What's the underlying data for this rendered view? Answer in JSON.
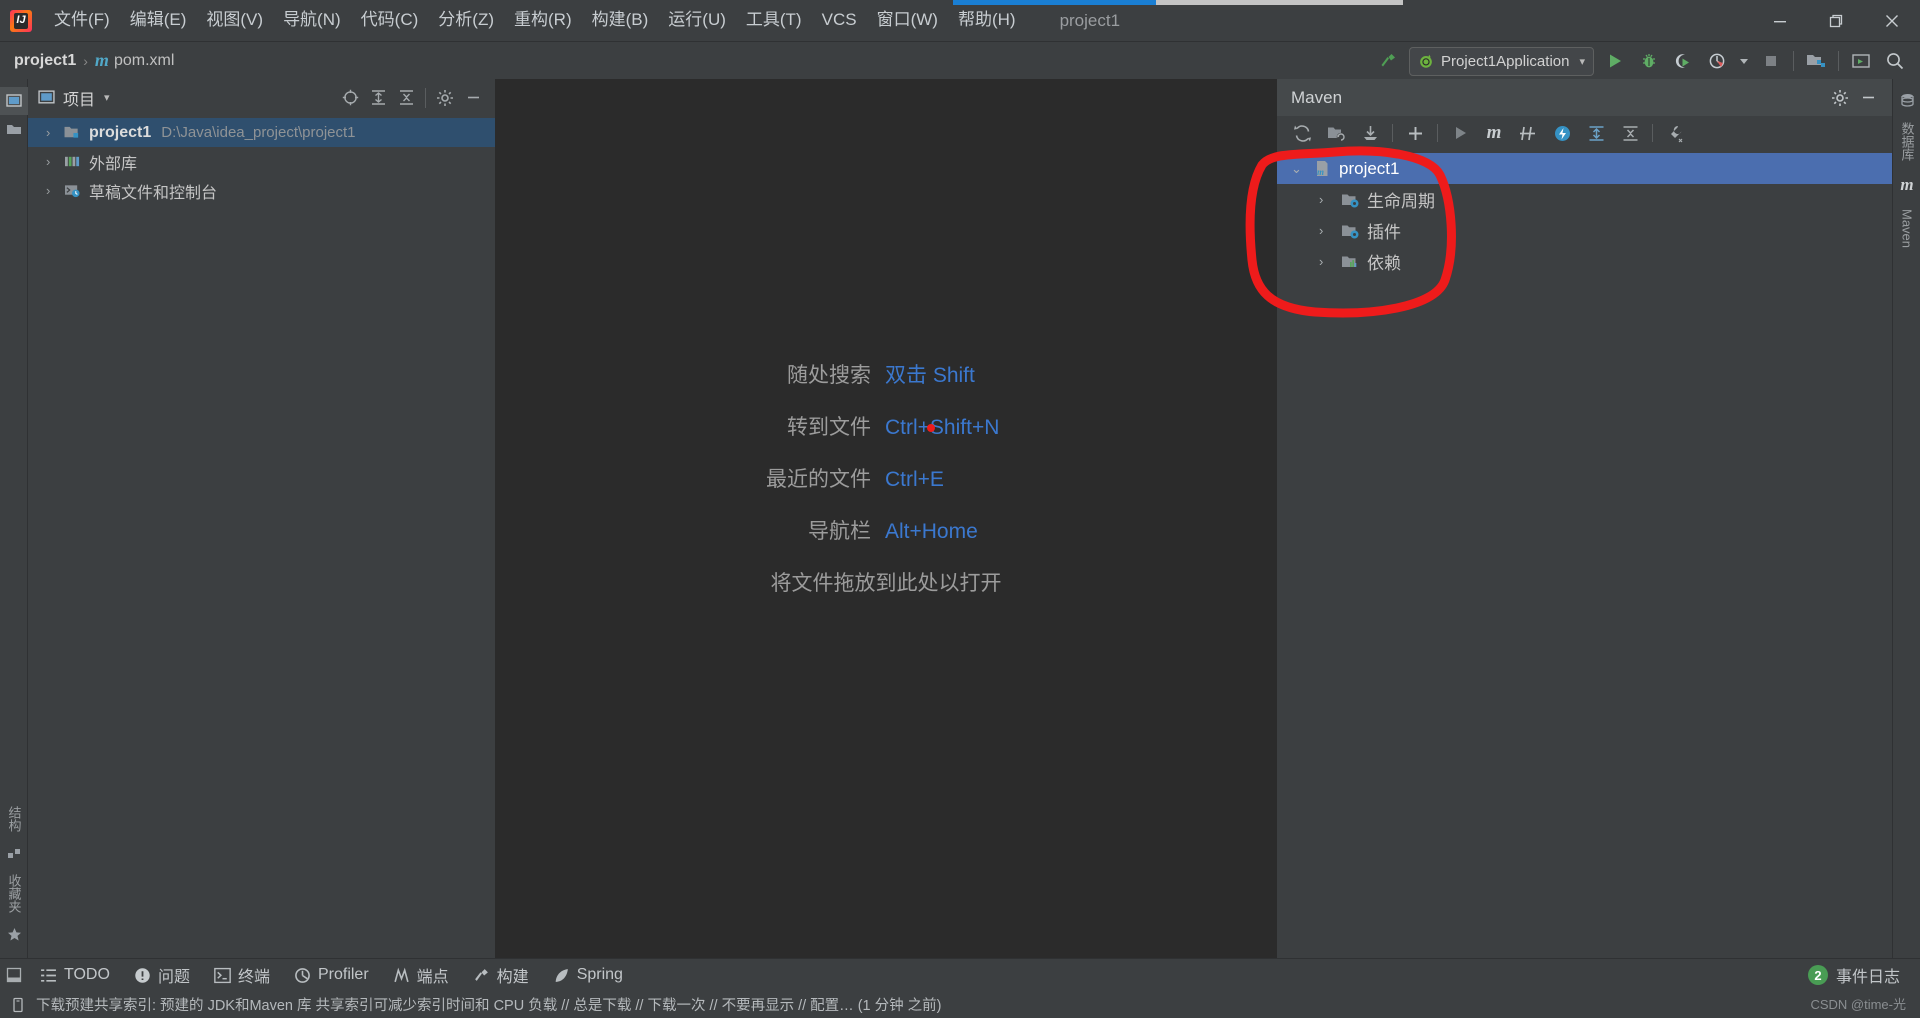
{
  "window": {
    "title": "project1",
    "logo_text": "IJ",
    "controls": [
      "minimize",
      "maximize",
      "close"
    ],
    "progress_percent": 45
  },
  "menubar": {
    "items": [
      {
        "label": "文件(F)",
        "name": "menu-file"
      },
      {
        "label": "编辑(E)",
        "name": "menu-edit"
      },
      {
        "label": "视图(V)",
        "name": "menu-view"
      },
      {
        "label": "导航(N)",
        "name": "menu-navigate"
      },
      {
        "label": "代码(C)",
        "name": "menu-code"
      },
      {
        "label": "分析(Z)",
        "name": "menu-analyze"
      },
      {
        "label": "重构(R)",
        "name": "menu-refactor"
      },
      {
        "label": "构建(B)",
        "name": "menu-build"
      },
      {
        "label": "运行(U)",
        "name": "menu-run"
      },
      {
        "label": "工具(T)",
        "name": "menu-tools"
      },
      {
        "label": "VCS",
        "name": "menu-vcs"
      },
      {
        "label": "窗口(W)",
        "name": "menu-window"
      },
      {
        "label": "帮助(H)",
        "name": "menu-help"
      }
    ]
  },
  "navbar": {
    "breadcrumb": {
      "project": "project1",
      "separator": "›",
      "file": "pom.xml",
      "file_icon": "maven-m-icon"
    },
    "run_config": {
      "label": "Project1Application",
      "icon": "spring-boot-icon",
      "caret": "▾"
    },
    "icons": [
      {
        "name": "build-hammer-icon"
      },
      {
        "name": "run-icon"
      },
      {
        "name": "debug-icon"
      },
      {
        "name": "run-with-coverage-icon"
      },
      {
        "name": "profiler-icon"
      },
      {
        "name": "profiler-dropdown-icon"
      },
      {
        "name": "stop-icon"
      },
      {
        "name": "project-structure-icon"
      },
      {
        "name": "terminal-icon"
      },
      {
        "name": "search-everywhere-icon"
      }
    ]
  },
  "stripes": {
    "left_top": [
      {
        "label": "项目",
        "name": "stripe-project"
      },
      {
        "label": "提交",
        "name": "stripe-commit"
      }
    ],
    "left_bottom": [
      {
        "label": "结构",
        "name": "stripe-structure"
      },
      {
        "label": "收藏夹",
        "name": "stripe-favorites"
      }
    ],
    "right_top": [
      {
        "label": "数据库",
        "name": "stripe-database"
      },
      {
        "label": "Maven",
        "name": "stripe-maven"
      }
    ]
  },
  "project_panel": {
    "title": "项目",
    "title_caret": "▾",
    "header_icons": [
      {
        "name": "select-opened-file-icon"
      },
      {
        "name": "expand-all-icon"
      },
      {
        "name": "collapse-all-icon"
      },
      {
        "name": "settings-gear-icon"
      },
      {
        "name": "hide-icon"
      }
    ],
    "tree": [
      {
        "label": "project1",
        "path": "D:\\Java\\idea_project\\project1",
        "icon": "module-folder-icon",
        "arrow": "›",
        "selected": true,
        "name": "tree-node-project1"
      },
      {
        "label": "外部库",
        "path": "",
        "icon": "library-icon",
        "arrow": "›",
        "selected": false,
        "name": "tree-node-external-libraries"
      },
      {
        "label": "草稿文件和控制台",
        "path": "",
        "icon": "scratches-icon",
        "arrow": "›",
        "selected": false,
        "name": "tree-node-scratches"
      }
    ]
  },
  "editor": {
    "hints": [
      {
        "left": "随处搜索",
        "right": "双击 Shift",
        "name": "hint-search-everywhere"
      },
      {
        "left": "转到文件",
        "right": "Ctrl+Shift+N",
        "name": "hint-go-to-file"
      },
      {
        "left": "最近的文件",
        "right": "Ctrl+E",
        "name": "hint-recent-files"
      },
      {
        "left": "导航栏",
        "right": "Alt+Home",
        "name": "hint-navigation-bar"
      },
      {
        "left": "将文件拖放到此处以打开",
        "right": "",
        "name": "hint-drop-files"
      }
    ]
  },
  "maven_panel": {
    "title": "Maven",
    "header_icons": [
      {
        "name": "settings-gear-icon"
      },
      {
        "name": "hide-icon"
      }
    ],
    "toolbar_icons": [
      {
        "name": "reload-all-projects-icon"
      },
      {
        "name": "add-maven-project-icon"
      },
      {
        "name": "download-sources-icon"
      },
      {
        "name": "add-icon"
      },
      {
        "name": "run-maven-build-icon"
      },
      {
        "name": "execute-maven-goal-icon"
      },
      {
        "name": "toggle-skip-tests-icon"
      },
      {
        "name": "offline-mode-icon"
      },
      {
        "name": "expand-all-icon"
      },
      {
        "name": "collapse-all-icon"
      },
      {
        "name": "maven-settings-wrench-icon"
      }
    ],
    "tree": [
      {
        "label": "project1",
        "icon": "maven-project-icon",
        "arrow": "⌄",
        "level": 1,
        "selected": true,
        "name": "maven-node-project1"
      },
      {
        "label": "生命周期",
        "icon": "lifecycle-folder-icon",
        "arrow": "›",
        "level": 2,
        "selected": false,
        "name": "maven-node-lifecycle"
      },
      {
        "label": "插件",
        "icon": "plugins-folder-icon",
        "arrow": "›",
        "level": 2,
        "selected": false,
        "name": "maven-node-plugins"
      },
      {
        "label": "依赖",
        "icon": "dependencies-folder-icon",
        "arrow": "›",
        "level": 2,
        "selected": false,
        "name": "maven-node-dependencies"
      }
    ]
  },
  "bottom_bar": {
    "items": [
      {
        "label": "TODO",
        "icon": "todo-icon",
        "name": "tool-todo"
      },
      {
        "label": "问题",
        "icon": "problems-icon",
        "name": "tool-problems"
      },
      {
        "label": "终端",
        "icon": "terminal-icon",
        "name": "tool-terminal"
      },
      {
        "label": "Profiler",
        "icon": "profiler-icon",
        "name": "tool-profiler"
      },
      {
        "label": "端点",
        "icon": "endpoints-icon",
        "name": "tool-endpoints"
      },
      {
        "label": "构建",
        "icon": "build-hammer-icon",
        "name": "tool-build"
      },
      {
        "label": "Spring",
        "icon": "spring-leaf-icon",
        "name": "tool-spring"
      }
    ],
    "event_log": {
      "label": "事件日志",
      "count": "2",
      "name": "tool-event-log"
    }
  },
  "status_bar": {
    "icon": "notification-icon",
    "message": "下载预建共享索引: 预建的 JDK和Maven 库 共享索引可减少索引时间和 CPU 负载 // 总是下载 // 下载一次 // 不要再显示 // 配置… (1 分钟 之前)"
  },
  "watermark": "CSDN @time-光",
  "colors": {
    "accent_blue": "#4b6eaf",
    "annotation_red": "#ee1b1b",
    "link_blue": "#3b78cf",
    "panel_bg": "#3c3f41",
    "editor_bg": "#2b2b2b",
    "selection_blue": "#2f4f6e"
  }
}
